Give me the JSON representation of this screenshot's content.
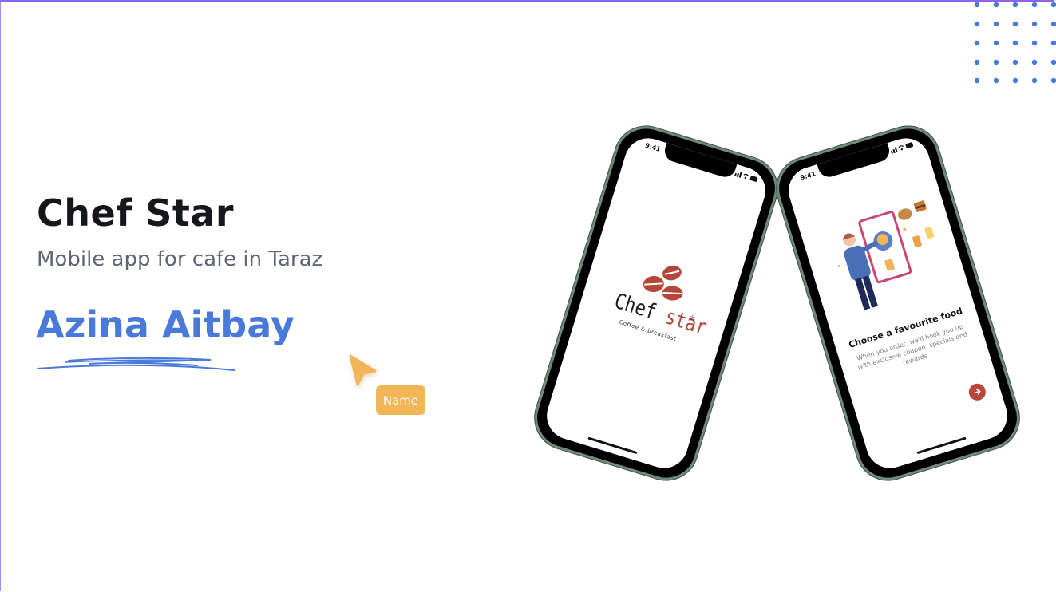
{
  "hero": {
    "title": "Chef Star",
    "subtitle": "Mobile app for cafe in Taraz",
    "author": "Azina Aitbay"
  },
  "cursor_tag": {
    "label": "Name",
    "color": "#f2b658"
  },
  "phone_splash": {
    "time": "9:41",
    "logo_word_main": "Chef ",
    "logo_word_accent": "star",
    "logo_registered": "®",
    "logo_tagline": "Coffee & breakfast",
    "logo_color": "#b4473a"
  },
  "phone_onboarding": {
    "time": "9:41",
    "title": "Choose a favourite food",
    "description": "When you order, we'll hook you up with exclusive coupon, specials and rewards",
    "next_icon": "arrow-right-icon",
    "accent": "#b6473a"
  },
  "colors": {
    "title": "#15171c",
    "subtitle": "#5e6577",
    "author": "#4a7ad9",
    "dots": "#4a7ad9",
    "frame": "#8a63f0"
  }
}
